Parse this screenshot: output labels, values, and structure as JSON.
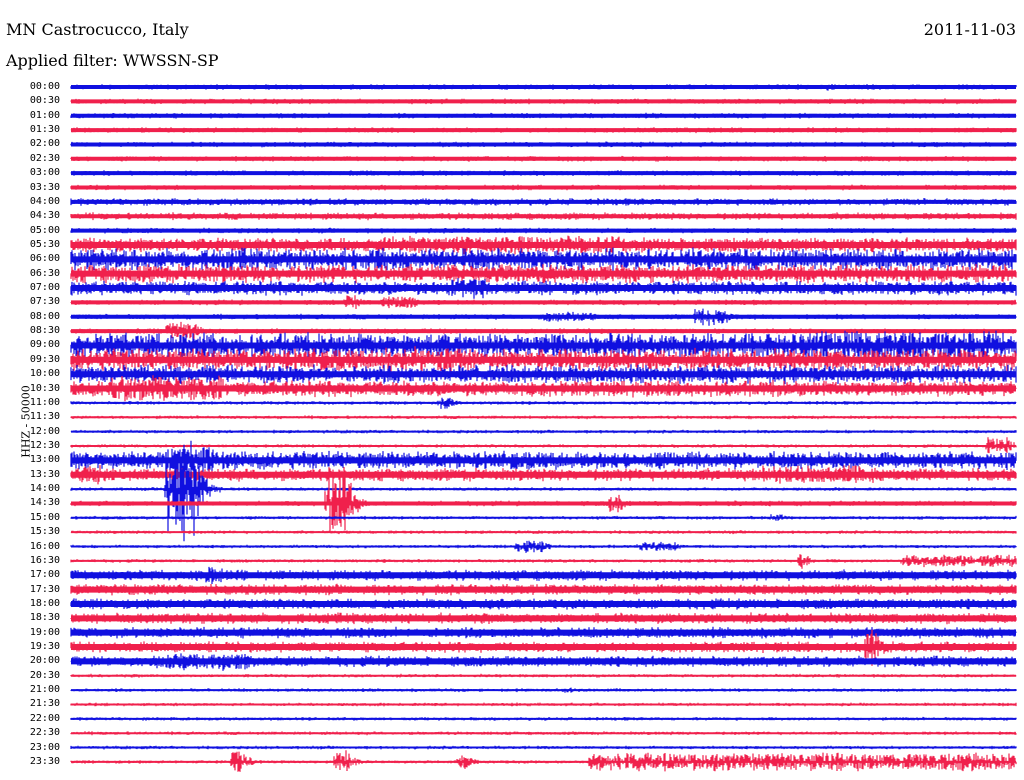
{
  "header": {
    "station": "MN Castrocucco, Italy",
    "date": "2011-11-03",
    "filter": "Applied filter: WWSSN-SP"
  },
  "ylabel": "HHZ - 50000",
  "colors": {
    "even": "#1010e0",
    "odd": "#f0204c"
  },
  "chart_data": {
    "type": "line",
    "title": "MN Castrocucco, Italy",
    "subtitle": "Applied filter: WWSSN-SP",
    "date": "2011-11-03",
    "ylabel": "HHZ - 50000",
    "row_labels": [
      "00:00",
      "00:30",
      "01:00",
      "01:30",
      "02:00",
      "02:30",
      "03:00",
      "03:30",
      "04:00",
      "04:30",
      "05:00",
      "05:30",
      "06:00",
      "06:30",
      "07:00",
      "07:30",
      "08:00",
      "08:30",
      "09:00",
      "09:30",
      "10:00",
      "10:30",
      "11:00",
      "11:30",
      "12:00",
      "12:30",
      "13:00",
      "13:30",
      "14:00",
      "14:30",
      "15:00",
      "15:30",
      "16:00",
      "16:30",
      "17:00",
      "17:30",
      "18:00",
      "18:30",
      "19:00",
      "19:30",
      "20:00",
      "20:30",
      "21:00",
      "21:30",
      "22:00",
      "22:30",
      "23:00",
      "23:30"
    ],
    "row_noise_amplitude": [
      3,
      3,
      3,
      3,
      3,
      3,
      3,
      3,
      4,
      4,
      3,
      8,
      12,
      10,
      8,
      3,
      3,
      3,
      14,
      12,
      10,
      9,
      2,
      2,
      2,
      2,
      10,
      7,
      2,
      3,
      2,
      2,
      2,
      2,
      6,
      6,
      6,
      6,
      6,
      6,
      6,
      2,
      2,
      2,
      2,
      2,
      2,
      2
    ],
    "events": [
      {
        "row": "00:00",
        "t": 0.8,
        "amp": 4,
        "dur": 0.005
      },
      {
        "row": "05:30",
        "t": 0.33,
        "amp": 10,
        "dur": 0.25
      },
      {
        "row": "06:00",
        "t": 0.3,
        "amp": 12,
        "dur": 0.1
      },
      {
        "row": "06:30",
        "t": 0.4,
        "amp": 10,
        "dur": 0.1
      },
      {
        "row": "07:00",
        "t": 0.4,
        "amp": 12,
        "dur": 0.04
      },
      {
        "row": "07:30",
        "t": 0.29,
        "amp": 9,
        "dur": 0.01
      },
      {
        "row": "07:30",
        "t": 0.33,
        "amp": 8,
        "dur": 0.03
      },
      {
        "row": "08:00",
        "t": 0.5,
        "amp": 6,
        "dur": 0.05
      },
      {
        "row": "08:00",
        "t": 0.66,
        "amp": 10,
        "dur": 0.03
      },
      {
        "row": "08:30",
        "t": 0.1,
        "amp": 10,
        "dur": 0.03
      },
      {
        "row": "09:00",
        "t": 0.78,
        "amp": 16,
        "dur": 0.2
      },
      {
        "row": "09:30",
        "t": 0.33,
        "amp": 14,
        "dur": 0.1
      },
      {
        "row": "10:00",
        "t": 0.1,
        "amp": 10,
        "dur": 0.05
      },
      {
        "row": "10:30",
        "t": 0.04,
        "amp": 14,
        "dur": 0.12
      },
      {
        "row": "11:00",
        "t": 0.39,
        "amp": 7,
        "dur": 0.01
      },
      {
        "row": "12:30",
        "t": 0.97,
        "amp": 10,
        "dur": 0.02
      },
      {
        "row": "13:00",
        "t": 0.1,
        "amp": 16,
        "dur": 0.05
      },
      {
        "row": "13:30",
        "t": 0.01,
        "amp": 12,
        "dur": 0.02
      },
      {
        "row": "13:30",
        "t": 0.73,
        "amp": 10,
        "dur": 0.12
      },
      {
        "row": "14:00",
        "t": 0.1,
        "amp": 55,
        "dur": 0.03
      },
      {
        "row": "14:30",
        "t": 0.27,
        "amp": 40,
        "dur": 0.02
      },
      {
        "row": "14:30",
        "t": 0.57,
        "amp": 10,
        "dur": 0.01
      },
      {
        "row": "15:00",
        "t": 0.74,
        "amp": 5,
        "dur": 0.01
      },
      {
        "row": "16:00",
        "t": 0.47,
        "amp": 7,
        "dur": 0.03
      },
      {
        "row": "16:00",
        "t": 0.6,
        "amp": 5,
        "dur": 0.04
      },
      {
        "row": "16:30",
        "t": 0.77,
        "amp": 9,
        "dur": 0.005
      },
      {
        "row": "16:30",
        "t": 0.88,
        "amp": 7,
        "dur": 0.12
      },
      {
        "row": "17:00",
        "t": 0.14,
        "amp": 10,
        "dur": 0.02
      },
      {
        "row": "19:30",
        "t": 0.84,
        "amp": 20,
        "dur": 0.01
      },
      {
        "row": "20:00",
        "t": 0.09,
        "amp": 10,
        "dur": 0.1
      },
      {
        "row": "21:00",
        "t": 0.52,
        "amp": 3,
        "dur": 0.01
      },
      {
        "row": "23:30",
        "t": 0.17,
        "amp": 14,
        "dur": 0.01
      },
      {
        "row": "23:30",
        "t": 0.28,
        "amp": 14,
        "dur": 0.01
      },
      {
        "row": "23:30",
        "t": 0.41,
        "amp": 8,
        "dur": 0.01
      },
      {
        "row": "23:30",
        "t": 0.55,
        "amp": 10,
        "dur": 0.45
      }
    ]
  }
}
